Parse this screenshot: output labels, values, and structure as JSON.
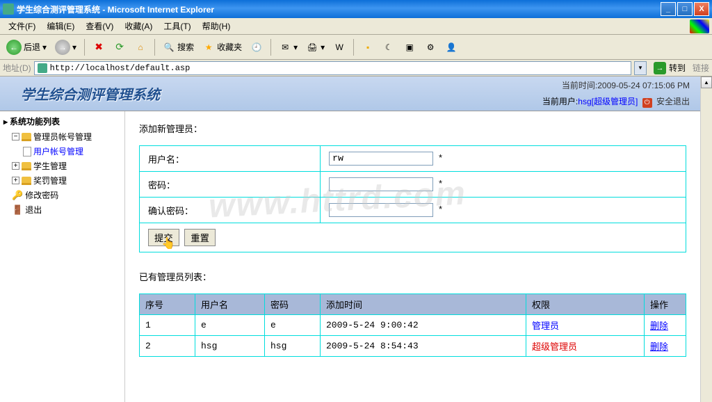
{
  "window": {
    "title": "学生综合测评管理系统 - Microsoft Internet Explorer"
  },
  "menu": {
    "file": "文件(F)",
    "edit": "编辑(E)",
    "view": "查看(V)",
    "favorites": "收藏(A)",
    "tools": "工具(T)",
    "help": "帮助(H)"
  },
  "toolbar": {
    "back": "后退",
    "search": "搜索",
    "favorites": "收藏夹"
  },
  "address": {
    "label": "地址(D)",
    "url": "http://localhost/default.asp",
    "go": "转到",
    "links": "链接"
  },
  "app": {
    "title": "学生综合测评管理系统",
    "timestamp_label": "当前时间:",
    "timestamp": "2009-05-24 07:15:06 PM",
    "user_label": "当前用户:",
    "user_name": "hsg",
    "user_role": "[超级管理员]",
    "logout": "安全退出"
  },
  "sidebar": {
    "title": "系统功能列表",
    "admin_mgmt": "管理员帐号管理",
    "user_acct": "用户帐号管理",
    "student_mgmt": "学生管理",
    "reward_mgmt": "奖罚管理",
    "change_pwd": "修改密码",
    "logout": "退出"
  },
  "form": {
    "section_title": "添加新管理员：",
    "username_label": "用户名：",
    "username_value": "rw",
    "password_label": "密码：",
    "password_value": "",
    "confirm_label": "确认密码：",
    "confirm_value": "",
    "submit": "提交",
    "reset": "重置"
  },
  "list": {
    "section_title": "已有管理员列表：",
    "headers": {
      "seq": "序号",
      "username": "用户名",
      "password": "密码",
      "add_time": "添加时间",
      "role": "权限",
      "action": "操作"
    },
    "rows": [
      {
        "seq": "1",
        "username": "e",
        "password": "e",
        "add_time": "2009-5-24 9:00:42",
        "role": "管理员",
        "role_class": "role-admin",
        "action": "删除"
      },
      {
        "seq": "2",
        "username": "hsg",
        "password": "hsg",
        "add_time": "2009-5-24 8:54:43",
        "role": "超级管理员",
        "role_class": "role-super",
        "action": "删除"
      }
    ]
  },
  "watermark": "www.httrd.com"
}
